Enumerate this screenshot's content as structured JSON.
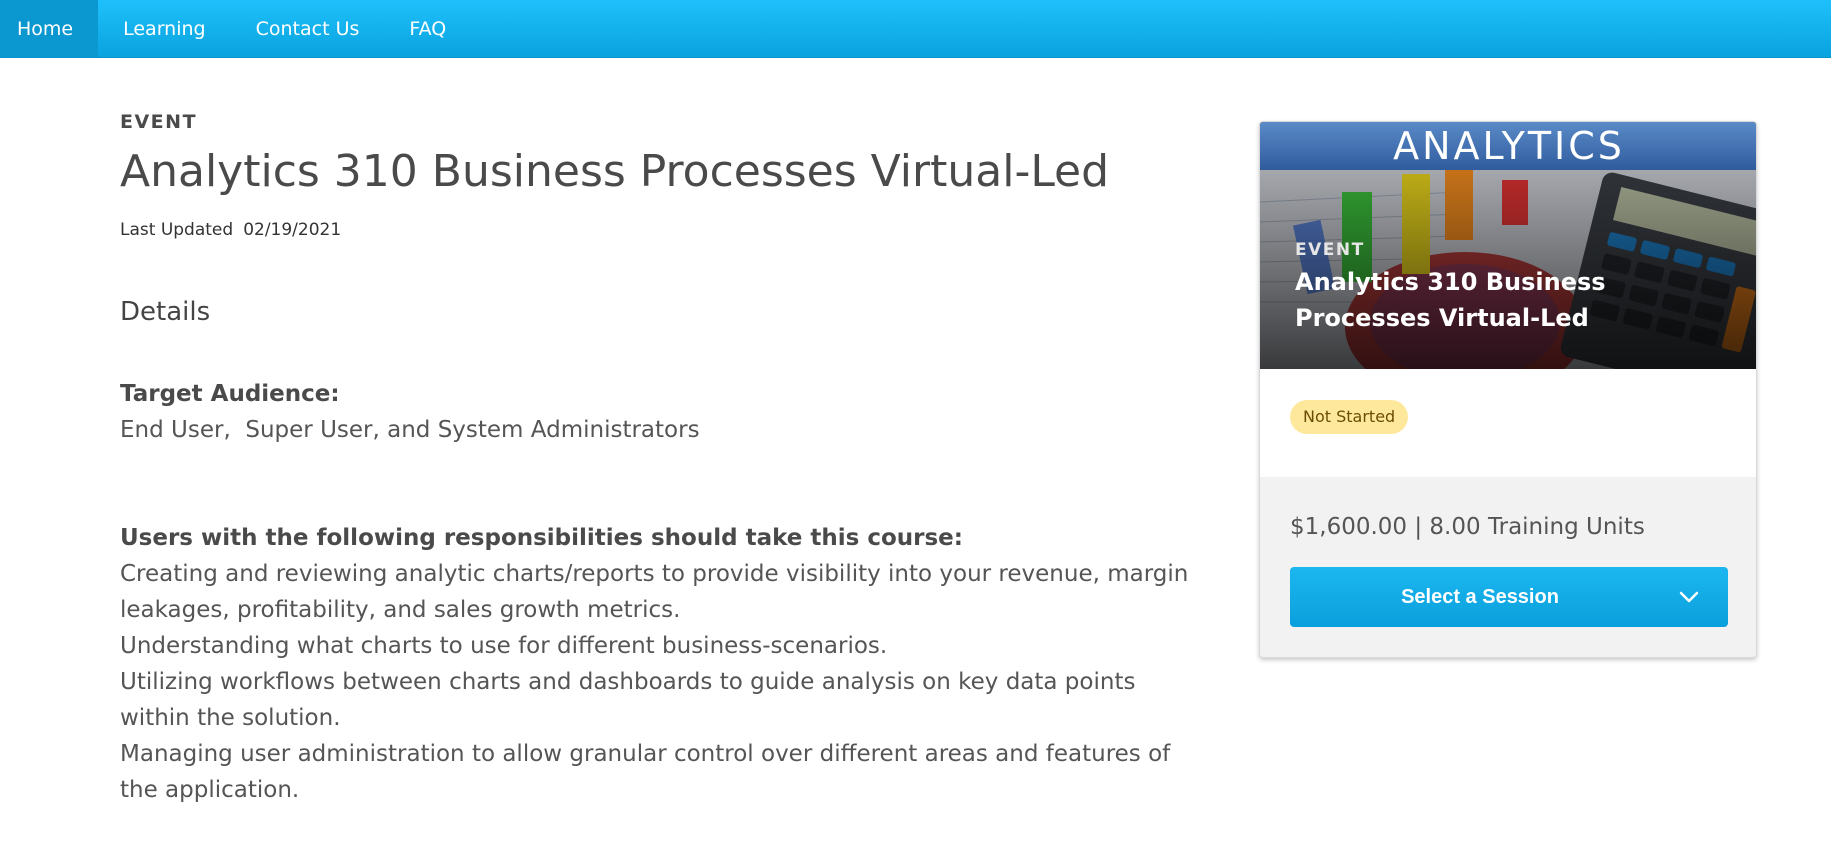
{
  "nav": {
    "items": [
      {
        "label": "Home",
        "active": true
      },
      {
        "label": "Learning"
      },
      {
        "label": "Contact Us"
      },
      {
        "label": "FAQ"
      }
    ]
  },
  "course": {
    "type": "EVENT",
    "title": "Analytics 310 Business Processes Virtual-Led",
    "last_updated_label": "Last Updated",
    "last_updated_value": "02/19/2021",
    "details_heading": "Details",
    "target_audience_label": "Target Audience:",
    "target_audience_value": "End User,  Super User, and System Administrators",
    "responsibilities_label": "Users with the following responsibilities should take this course:",
    "responsibilities": [
      "Creating and reviewing analytic charts/reports to provide visibility into your revenue, margin leakages, profitability, and sales growth metrics.",
      "Understanding what charts to use for different business-scenarios.",
      "Utilizing workflows between charts and dashboards to guide analysis on key data points within the solution.",
      "Managing user administration to allow granular control over different areas and features of the application."
    ]
  },
  "card": {
    "image_text": "ANALYTICS",
    "eyebrow": "EVENT",
    "title": "Analytics 310 Business Processes Virtual-Led",
    "status": "Not Started",
    "price": "$1,600.00 | 8.00 Training Units",
    "select_label": "Select a Session",
    "select_icon": "chevron-down-icon"
  }
}
